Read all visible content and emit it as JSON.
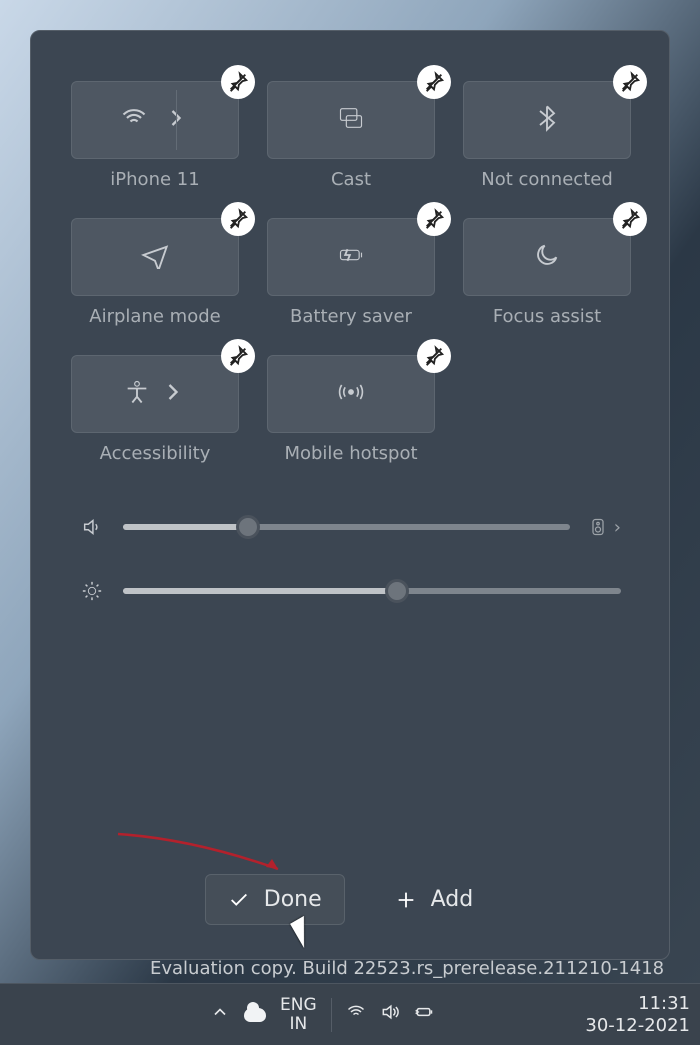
{
  "panel": {
    "tiles": [
      {
        "id": "wifi",
        "label": "iPhone 11",
        "icon": "wifi",
        "split": true
      },
      {
        "id": "cast",
        "label": "Cast",
        "icon": "cast",
        "split": false
      },
      {
        "id": "bt",
        "label": "Not connected",
        "icon": "bluetooth",
        "split": false
      },
      {
        "id": "airplane",
        "label": "Airplane mode",
        "icon": "airplane",
        "split": false
      },
      {
        "id": "battery",
        "label": "Battery saver",
        "icon": "battery",
        "split": false
      },
      {
        "id": "focus",
        "label": "Focus assist",
        "icon": "moon",
        "split": false
      },
      {
        "id": "access",
        "label": "Accessibility",
        "icon": "person",
        "split": true
      },
      {
        "id": "hotspot",
        "label": "Mobile hotspot",
        "icon": "hotspot",
        "split": false
      }
    ],
    "sliders": {
      "volume": {
        "value": 28
      },
      "brightness": {
        "value": 55
      }
    },
    "footer": {
      "done": "Done",
      "add": "Add"
    }
  },
  "watermark": "Evaluation copy. Build 22523.rs_prerelease.211210-1418",
  "taskbar": {
    "language_top": "ENG",
    "language_bottom": "IN",
    "clock_time": "11:31",
    "clock_date": "30-12-2021"
  }
}
